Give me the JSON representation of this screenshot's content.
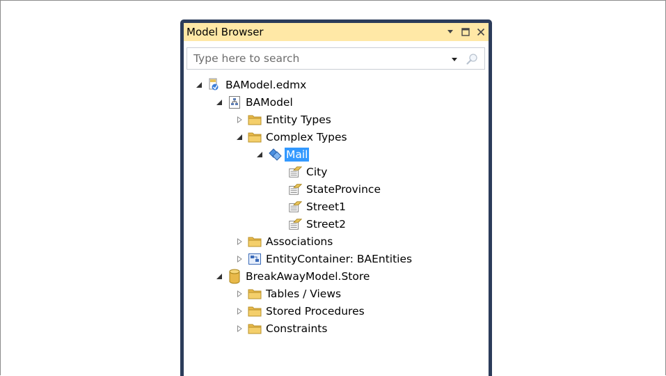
{
  "window": {
    "title": "Model Browser"
  },
  "search": {
    "placeholder": "Type here to search"
  },
  "tree": {
    "root_label": "BAModel.edmx",
    "model_label": "BAModel",
    "entity_types_label": "Entity Types",
    "complex_types_label": "Complex Types",
    "mail_label": "Mail",
    "city_label": "City",
    "state_province_label": "StateProvince",
    "street1_label": "Street1",
    "street2_label": "Street2",
    "associations_label": "Associations",
    "entity_container_label": "EntityContainer: BAEntities",
    "store_label": "BreakAwayModel.Store",
    "tables_views_label": "Tables / Views",
    "stored_procedures_label": "Stored Procedures",
    "constraints_label": "Constraints"
  },
  "colors": {
    "title_bar": "#ffe8a6",
    "panel_border": "#2c3c5a",
    "selection": "#3399ff",
    "folder": "#e8b94a"
  }
}
